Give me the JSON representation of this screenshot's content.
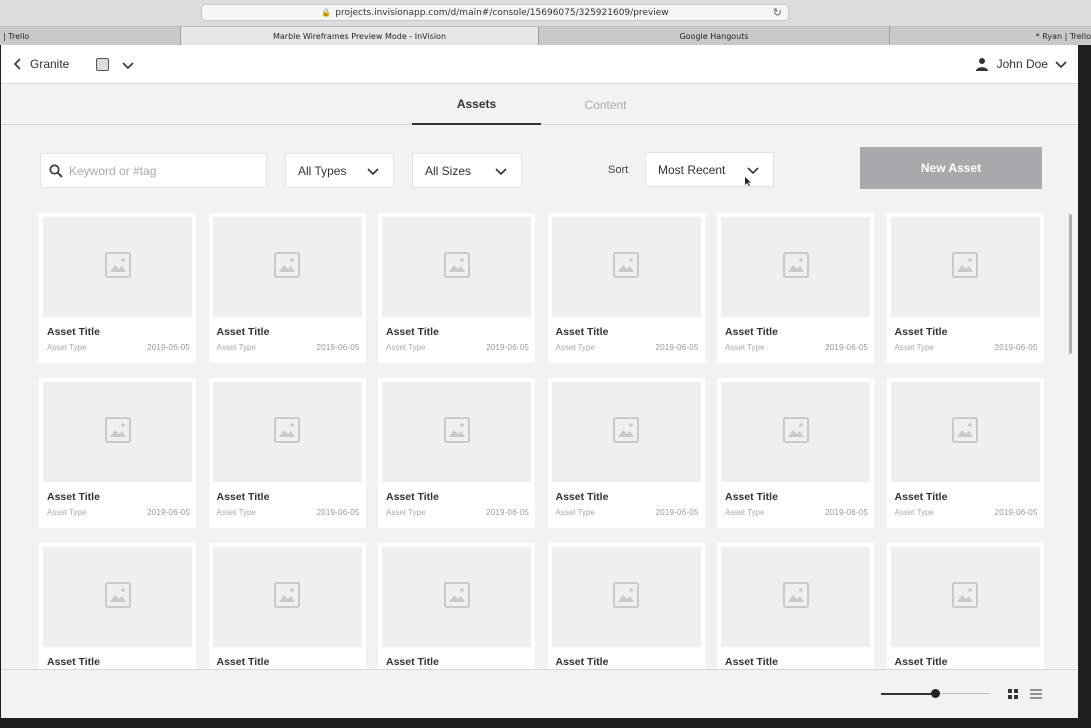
{
  "browser": {
    "url": "projects.invisionapp.com/d/main#/console/15696075/325921609/preview",
    "tabs": [
      {
        "label": "| Trello"
      },
      {
        "label": "Marble Wireframes Preview Mode - InVision"
      },
      {
        "label": "Google Hangouts"
      },
      {
        "label": "* Ryan | Trello"
      }
    ]
  },
  "header": {
    "back_label": "Granite",
    "user_name": "John Doe"
  },
  "subnav": {
    "tabs": [
      {
        "label": "Assets",
        "active": true
      },
      {
        "label": "Content",
        "active": false
      }
    ]
  },
  "filters": {
    "search_placeholder": "Keyword or #tag",
    "type_select": "All Types",
    "size_select": "All Sizes",
    "sort_label": "Sort",
    "sort_select": "Most Recent",
    "new_asset_label": "New Asset"
  },
  "assets": [
    {
      "title": "Asset Title",
      "type": "Asset Type",
      "date": "2019-06-05"
    },
    {
      "title": "Asset Title",
      "type": "Asset Type",
      "date": "2019-06-05"
    },
    {
      "title": "Asset Title",
      "type": "Asset Type",
      "date": "2019-06-05"
    },
    {
      "title": "Asset Title",
      "type": "Asset Type",
      "date": "2019-06-05"
    },
    {
      "title": "Asset Title",
      "type": "Asset Type",
      "date": "2019-06-05"
    },
    {
      "title": "Asset Title",
      "type": "Asset Type",
      "date": "2019-06-05"
    },
    {
      "title": "Asset Title",
      "type": "Asset Type",
      "date": "2019-06-05"
    },
    {
      "title": "Asset Title",
      "type": "Asset Type",
      "date": "2019-06-05"
    },
    {
      "title": "Asset Title",
      "type": "Asset Type",
      "date": "2019-06-05"
    },
    {
      "title": "Asset Title",
      "type": "Asset Type",
      "date": "2019-06-05"
    },
    {
      "title": "Asset Title",
      "type": "Asset Type",
      "date": "2019-06-05"
    },
    {
      "title": "Asset Title",
      "type": "Asset Type",
      "date": "2019-06-05"
    },
    {
      "title": "Asset Title",
      "type": "",
      "date": ""
    },
    {
      "title": "Asset Title",
      "type": "",
      "date": ""
    },
    {
      "title": "Asset Title",
      "type": "",
      "date": ""
    },
    {
      "title": "Asset Title",
      "type": "",
      "date": ""
    },
    {
      "title": "Asset Title",
      "type": "",
      "date": ""
    },
    {
      "title": "Asset Title",
      "type": "",
      "date": ""
    }
  ],
  "footer": {
    "zoom_level": 0.5
  },
  "colors": {
    "new_asset_button": "#a8a9ad",
    "app_background": "#f1f2f4"
  }
}
